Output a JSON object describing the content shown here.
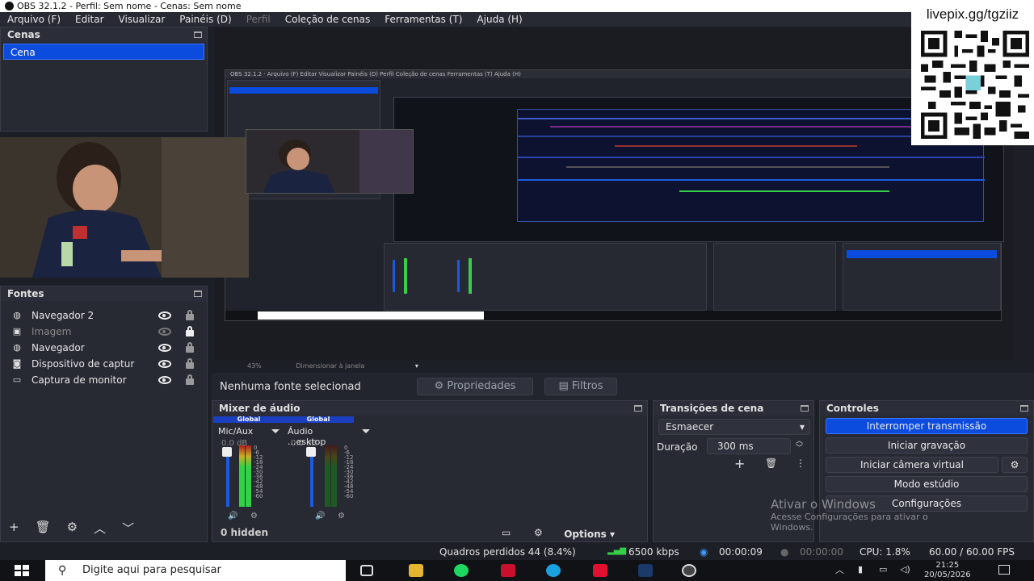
{
  "window": {
    "title": "OBS 32.1.2 - Perfil: Sem nome - Cenas: Sem nome"
  },
  "menu": [
    "Arquivo (F)",
    "Editar",
    "Visualizar",
    "Painéis (D)",
    "Perfil",
    "Coleção de cenas",
    "Ferramentas (T)",
    "Ajuda (H)"
  ],
  "overlay": {
    "livepix": "livepix.gg/tgziiz"
  },
  "scenes": {
    "title": "Cenas",
    "items": [
      "Cena"
    ]
  },
  "sources": {
    "title": "Fontes",
    "items": [
      {
        "label": "Navegador 2",
        "icon": "globe-icon",
        "visible": true,
        "locked": false
      },
      {
        "label": "Imagem",
        "icon": "image-icon",
        "visible": false,
        "locked": true
      },
      {
        "label": "Navegador",
        "icon": "globe-icon",
        "visible": true,
        "locked": false
      },
      {
        "label": "Dispositivo de captur",
        "icon": "camera-icon",
        "visible": true,
        "locked": false
      },
      {
        "label": "Captura de monitor",
        "icon": "monitor-icon",
        "visible": true,
        "locked": false
      }
    ]
  },
  "preview": {
    "zoom": "43%",
    "resize_mode": "Dimensionar à janela"
  },
  "source_toolbar": {
    "no_source": "Nenhuma fonte selecionad",
    "properties": "Propriedades",
    "filters": "Filtros"
  },
  "mixer": {
    "title": "Mixer de áudio",
    "channels": [
      {
        "header": "Global",
        "name": "Mic/Aux",
        "db": "0.0 dB"
      },
      {
        "header": "Global",
        "name": "Áudio ...esktop",
        "db": "0.0 dB"
      }
    ],
    "ticks": [
      "0",
      "-6",
      "-12",
      "-18",
      "-24",
      "-30",
      "-36",
      "-42",
      "-48",
      "-54",
      "-60"
    ],
    "hidden": "0 hidden",
    "options": "Options"
  },
  "transitions": {
    "title": "Transições de cena",
    "selected": "Esmaecer",
    "duration_label": "Duração",
    "duration_value": "300 ms"
  },
  "controls": {
    "title": "Controles",
    "stop_stream": "Interromper transmissão",
    "start_recording": "Iniciar gravação",
    "start_virtual_cam": "Iniciar câmera virtual",
    "studio_mode": "Modo estúdio",
    "settings": "Configurações"
  },
  "watermark": {
    "line1": "Ativar o Windows",
    "line2": "Acesse Configurações para ativar o",
    "line3": "Windows."
  },
  "status": {
    "dropped": "Quadros perdidos 44 (8.4%)",
    "bitrate": "6500 kbps",
    "stream_time": "00:00:09",
    "rec_time": "00:00:00",
    "cpu": "CPU: 1.8%",
    "fps": "60.00 / 60.00 FPS"
  },
  "taskbar": {
    "search_placeholder": "Digite aqui para pesquisar",
    "time": "21:25",
    "date": "20/05/2026"
  },
  "colors": {
    "accent": "#0b4cde",
    "meter_green": "#35d04a",
    "meter_red": "#b02020"
  }
}
